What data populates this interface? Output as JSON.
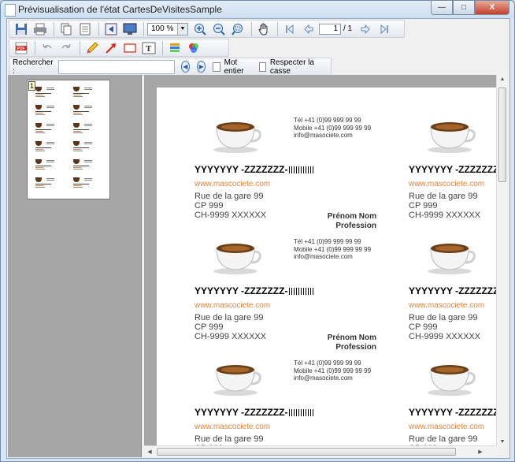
{
  "window": {
    "title": "Prévisualisation de l'état CartesDeVisitesSample",
    "controls": {
      "minimize": "—",
      "maximize": "□",
      "close": "X"
    }
  },
  "toolbar": {
    "zoom_value": "100 %",
    "page_current": "1",
    "page_total": "/ 1"
  },
  "search": {
    "label": "Rechercher :",
    "value": "",
    "whole_word_label": "Mot entier",
    "match_case_label": "Respecter la casse"
  },
  "thumbnails": {
    "page_number": "1"
  },
  "card": {
    "name": "YYYYYYY -ZZZZZZZ-",
    "website": "www.mascociete.com",
    "address_line1": "Rue de la gare 99",
    "address_line2": "CP 999",
    "address_line3": "CH-9999 XXXXXX",
    "phone_line": "Tél      +41 (0)99 999 99 99",
    "mobile_line": "Mobile +41 (0)99 999 99 99",
    "email": "info@masociete.com",
    "person_name": "Prénom Nom",
    "person_profession": "Profession"
  },
  "icons": [
    "save-icon",
    "print-icon",
    "copy-icon",
    "document-icon",
    "fit-page-icon",
    "monitor-icon",
    "zoom-in-icon",
    "zoom-out-icon",
    "zoom-select-icon",
    "hand-icon",
    "first-page-icon",
    "previous-page-icon",
    "next-page-icon",
    "last-page-icon",
    "pdf-icon",
    "undo-icon",
    "redo-icon",
    "pencil-icon",
    "arrow-icon",
    "rectangle-icon",
    "text-icon",
    "layers-icon",
    "color-icon"
  ],
  "colors": {
    "website": "#e8823c",
    "titlebar": "#cfdff0",
    "preview_background": "#a6a6a6"
  }
}
